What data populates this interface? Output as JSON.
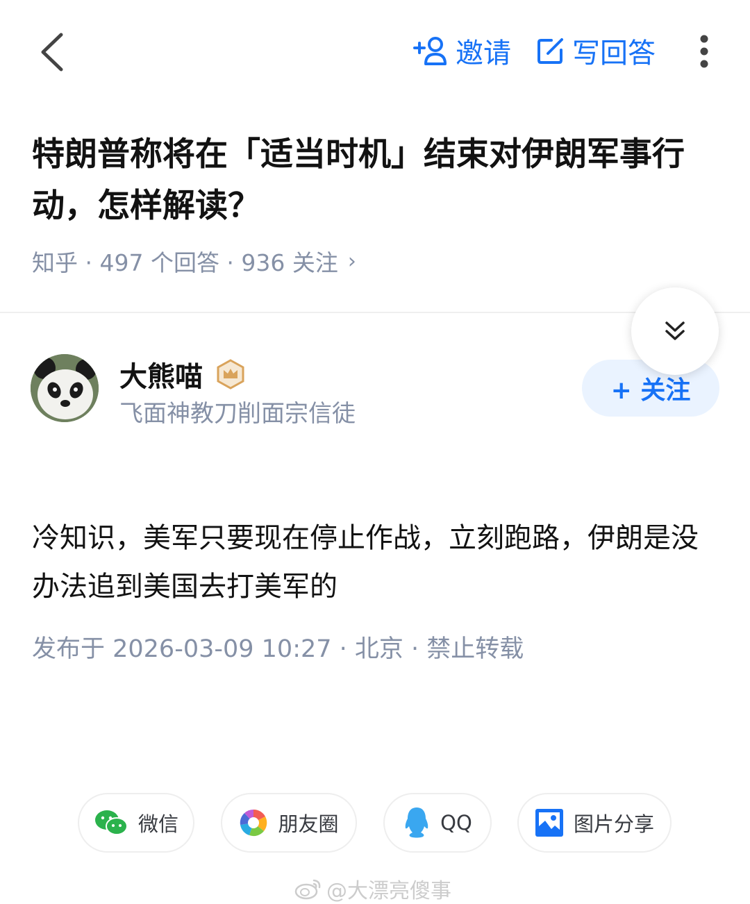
{
  "header": {
    "invite_label": "邀请",
    "write_answer_label": "写回答"
  },
  "question": {
    "title": "特朗普称将在「适当时机」结束对伊朗军事行动，怎样解读？",
    "meta": "知乎 · 497  个回答 · 936  关注",
    "meta_arrow": "›"
  },
  "author": {
    "name": "大熊喵",
    "bio": "飞面神教刀削面宗信徒",
    "follow_label": "+ 关注"
  },
  "answer": {
    "body": "冷知识，美军只要现在停止作战，立刻跑路，伊朗是没办法追到美国去打美军的",
    "meta": "发布于  2026-03-09  10:27 · 北京 · 禁止转载"
  },
  "share": {
    "wechat": "微信",
    "moments": "朋友圈",
    "qq": "QQ",
    "image_share": "图片分享"
  },
  "watermark": {
    "text": "@大漂亮傻事"
  },
  "colors": {
    "accent": "#1772f6",
    "muted": "#8590a6",
    "follow_bg": "#eaf3ff",
    "badge_gold": "#d9a35b",
    "wechat_green": "#2bb24c",
    "qq_blue": "#3aa7f0"
  }
}
